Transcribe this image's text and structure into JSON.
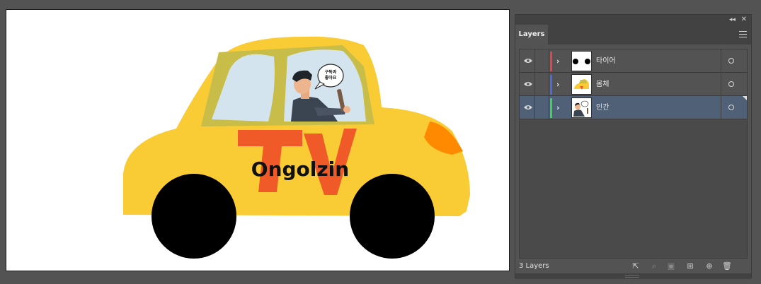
{
  "artboard": {
    "car_text": "Ongolzin",
    "car_logo": "TV",
    "speech_bubble": "구독과 좋아요",
    "colors": {
      "body": "#F9CB34",
      "logo": "#F05A28",
      "window": "#D4E4EF",
      "window_frame": "#C9BD4A",
      "light": "#FF8A00",
      "wheel": "#000000"
    }
  },
  "panel": {
    "title": "Layers",
    "collapse_icon": "double-chevron-left-icon",
    "close_icon": "close-icon",
    "menu_icon": "hamburger-menu-icon",
    "layers": [
      {
        "name": "타이어",
        "color": "#E8424A",
        "thumbnail": "wheels"
      },
      {
        "name": "몸체",
        "color": "#4A6BE0",
        "thumbnail": "car-body"
      },
      {
        "name": "인간",
        "color": "#39D45A",
        "thumbnail": "person",
        "selected": true
      }
    ],
    "status": "3 Layers",
    "footer_icons": [
      "export-icon",
      "search-icon",
      "clipping-mask-icon",
      "new-sublayer-icon",
      "new-layer-icon",
      "trash-icon"
    ]
  }
}
